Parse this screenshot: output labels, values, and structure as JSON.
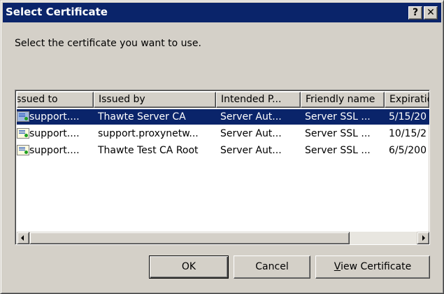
{
  "window": {
    "title": "Select Certificate",
    "help_label": "?",
    "close_label": "✕"
  },
  "prompt": "Select the certificate you want to use.",
  "list": {
    "columns": [
      {
        "label": "Issued to"
      },
      {
        "label": "Issued by"
      },
      {
        "label": "Intended P..."
      },
      {
        "label": "Friendly name"
      },
      {
        "label": "Expiratio"
      }
    ],
    "rows": [
      {
        "selected": true,
        "issued_to": "support....",
        "issued_by": "Thawte Server CA",
        "intended": "Server Aut...",
        "friendly": "Server SSL ...",
        "expiration": "5/15/20"
      },
      {
        "selected": false,
        "issued_to": "support....",
        "issued_by": "support.proxynetw...",
        "intended": "Server Aut...",
        "friendly": "Server SSL ...",
        "expiration": "10/15/2"
      },
      {
        "selected": false,
        "issued_to": "support....",
        "issued_by": "Thawte Test CA Root",
        "intended": "Server Aut...",
        "friendly": "Server SSL ...",
        "expiration": "6/5/200"
      }
    ],
    "row_icon": "certificate-icon"
  },
  "buttons": {
    "ok": "OK",
    "cancel": "Cancel",
    "view_mnemonic": "V",
    "view_rest": "iew Certificate"
  },
  "colors": {
    "titlebar": "#0a246a",
    "selection": "#0a246a",
    "face": "#d4d0c8"
  }
}
